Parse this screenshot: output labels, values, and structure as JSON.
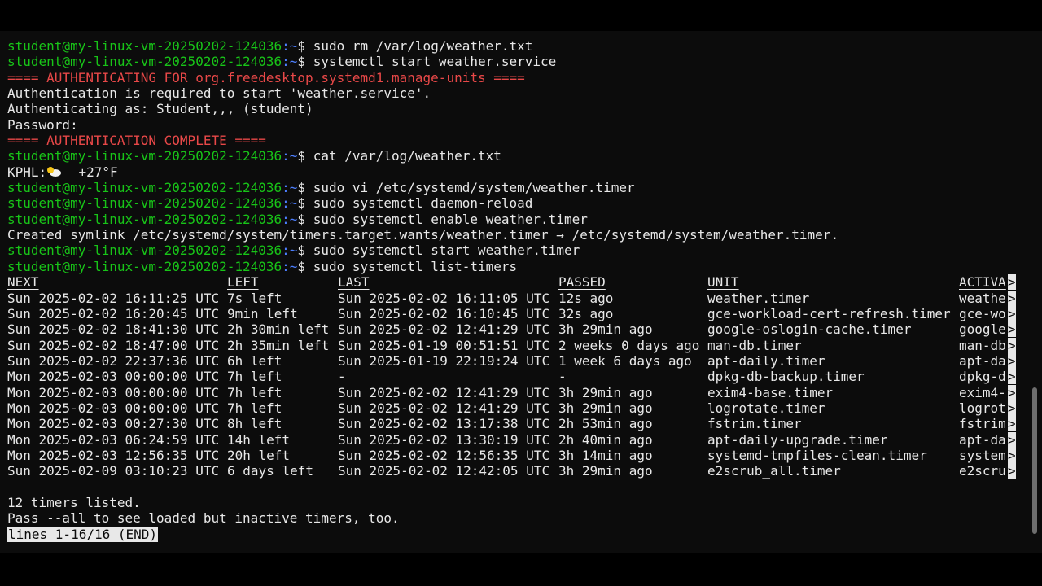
{
  "prompt": {
    "user_host": "student@my-linux-vm-20250202-124036",
    "path": ":~",
    "symbol": "$"
  },
  "history": [
    {
      "kind": "cmd",
      "text": " sudo rm /var/log/weather.txt"
    },
    {
      "kind": "cmd",
      "text": " systemctl start weather.service"
    },
    {
      "kind": "alert",
      "text": "==== AUTHENTICATING FOR org.freedesktop.systemd1.manage-units ===="
    },
    {
      "kind": "out",
      "text": "Authentication is required to start 'weather.service'."
    },
    {
      "kind": "out",
      "text": "Authenticating as: Student,,, (student)"
    },
    {
      "kind": "out",
      "text": "Password:"
    },
    {
      "kind": "alert",
      "text": "==== AUTHENTICATION COMPLETE ===="
    },
    {
      "kind": "cmd",
      "text": " cat /var/log/weather.txt"
    },
    {
      "kind": "weather",
      "station": "KPHL:",
      "temp": "+27°F",
      "icon": "cloud-sun-icon"
    },
    {
      "kind": "cmd",
      "text": " sudo vi /etc/systemd/system/weather.timer"
    },
    {
      "kind": "cmd",
      "text": " sudo systemctl daemon-reload"
    },
    {
      "kind": "cmd",
      "text": " sudo systemctl enable weather.timer"
    },
    {
      "kind": "out",
      "text": "Created symlink /etc/systemd/system/timers.target.wants/weather.timer → /etc/systemd/system/weather.timer."
    },
    {
      "kind": "cmd",
      "text": " sudo systemctl start weather.timer"
    },
    {
      "kind": "cmd",
      "text": " sudo systemctl list-timers"
    }
  ],
  "timers": {
    "headers": [
      "NEXT",
      "LEFT",
      "LAST",
      "PASSED",
      "UNIT",
      "ACTIVA"
    ],
    "rows": [
      [
        "Sun 2025-02-02 16:11:25 UTC",
        "7s left",
        "Sun 2025-02-02 16:11:05 UTC",
        "12s ago",
        "weather.timer",
        "weathe"
      ],
      [
        "Sun 2025-02-02 16:20:45 UTC",
        "9min left",
        "Sun 2025-02-02 16:10:45 UTC",
        "32s ago",
        "gce-workload-cert-refresh.timer",
        "gce-wo"
      ],
      [
        "Sun 2025-02-02 18:41:30 UTC",
        "2h 30min left",
        "Sun 2025-02-02 12:41:29 UTC",
        "3h 29min ago",
        "google-oslogin-cache.timer",
        "google"
      ],
      [
        "Sun 2025-02-02 18:47:00 UTC",
        "2h 35min left",
        "Sun 2025-01-19 00:51:51 UTC",
        "2 weeks 0 days ago",
        "man-db.timer",
        "man-db"
      ],
      [
        "Sun 2025-02-02 22:37:36 UTC",
        "6h left",
        "Sun 2025-01-19 22:19:24 UTC",
        "1 week 6 days ago",
        "apt-daily.timer",
        "apt-da"
      ],
      [
        "Mon 2025-02-03 00:00:00 UTC",
        "7h left",
        "-",
        "-",
        "dpkg-db-backup.timer",
        "dpkg-d"
      ],
      [
        "Mon 2025-02-03 00:00:00 UTC",
        "7h left",
        "Sun 2025-02-02 12:41:29 UTC",
        "3h 29min ago",
        "exim4-base.timer",
        "exim4-"
      ],
      [
        "Mon 2025-02-03 00:00:00 UTC",
        "7h left",
        "Sun 2025-02-02 12:41:29 UTC",
        "3h 29min ago",
        "logrotate.timer",
        "logrot"
      ],
      [
        "Mon 2025-02-03 00:27:30 UTC",
        "8h left",
        "Sun 2025-02-02 13:17:38 UTC",
        "2h 53min ago",
        "fstrim.timer",
        "fstrim"
      ],
      [
        "Mon 2025-02-03 06:24:59 UTC",
        "14h left",
        "Sun 2025-02-02 13:30:19 UTC",
        "2h 40min ago",
        "apt-daily-upgrade.timer",
        "apt-da"
      ],
      [
        "Mon 2025-02-03 12:56:35 UTC",
        "20h left",
        "Sun 2025-02-02 12:56:35 UTC",
        "3h 14min ago",
        "systemd-tmpfiles-clean.timer",
        "system"
      ],
      [
        "Sun 2025-02-09 03:10:23 UTC",
        "6 days left",
        "Sun 2025-02-02 12:42:05 UTC",
        "3h 29min ago",
        "e2scrub_all.timer",
        "e2scru"
      ]
    ],
    "truncation_marker": ">"
  },
  "footer": {
    "count": "12 timers listed.",
    "hint": "Pass --all to see loaded but inactive timers, too."
  },
  "pager_status": "lines 1-16/16 (END)"
}
